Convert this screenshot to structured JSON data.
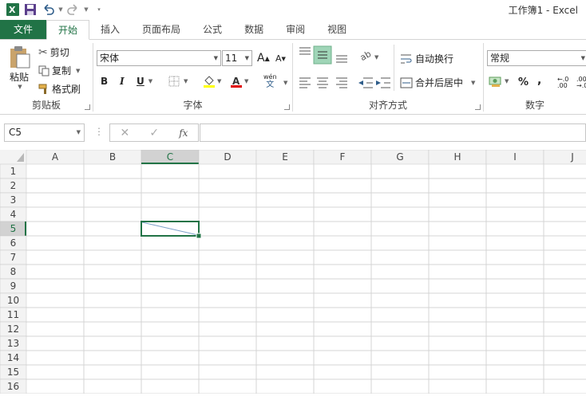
{
  "window": {
    "title": "工作簿1 - Excel"
  },
  "qat": {
    "save": "save-icon",
    "undo": "undo-icon",
    "redo": "redo-icon"
  },
  "tabs": [
    {
      "label": "文件",
      "kind": "file"
    },
    {
      "label": "开始",
      "kind": "active"
    },
    {
      "label": "插入"
    },
    {
      "label": "页面布局"
    },
    {
      "label": "公式"
    },
    {
      "label": "数据"
    },
    {
      "label": "审阅"
    },
    {
      "label": "视图"
    }
  ],
  "clipboard": {
    "group": "剪贴板",
    "paste": "粘贴",
    "cut": "剪切",
    "copy": "复制",
    "format_painter": "格式刷"
  },
  "font": {
    "group": "字体",
    "name": "宋体",
    "size": "11",
    "bold": "B",
    "italic": "I",
    "underline": "U",
    "phonetic": "wén",
    "phonetic_char": "文"
  },
  "alignment": {
    "group": "对齐方式",
    "wrap": "自动换行",
    "merge": "合并后居中"
  },
  "number": {
    "group": "数字",
    "format": "常规",
    "percent": "%",
    "comma": ","
  },
  "formula_bar": {
    "name_box": "C5",
    "fx": "fx",
    "formula": ""
  },
  "sheet": {
    "columns": [
      "A",
      "B",
      "C",
      "D",
      "E",
      "F",
      "G",
      "H",
      "I",
      "J"
    ],
    "rows": [
      "1",
      "2",
      "3",
      "4",
      "5",
      "6",
      "7",
      "8",
      "9",
      "10",
      "11",
      "12",
      "13",
      "14",
      "15",
      "16"
    ],
    "active_cell": "C5",
    "colors": {
      "accent": "#217346",
      "grid": "#d4d4d4",
      "header_bg": "#f3f3f3",
      "diag": "#7fa3c9"
    }
  }
}
